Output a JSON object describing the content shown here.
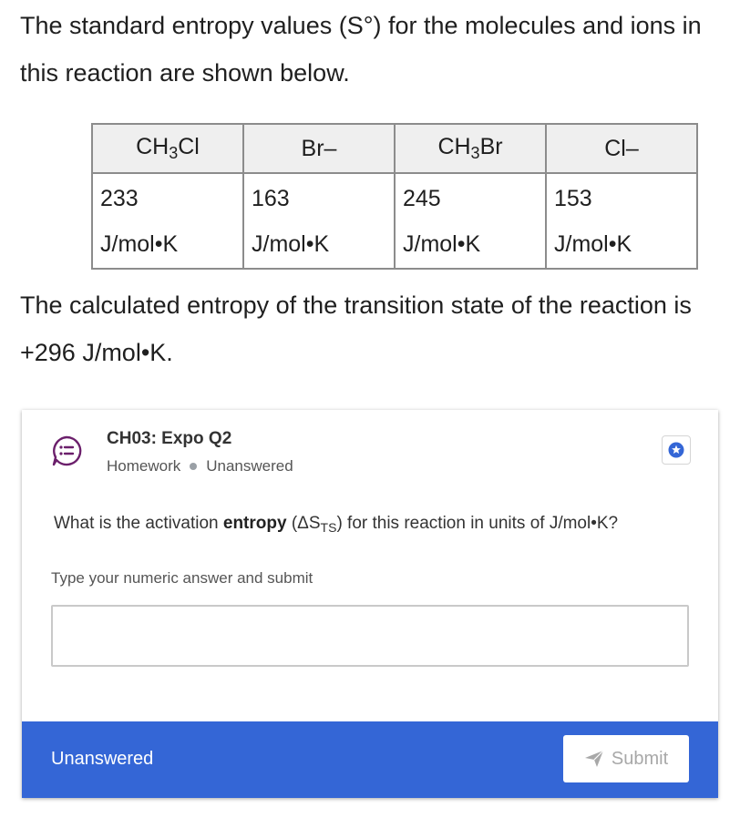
{
  "intro": {
    "line1": "The standard entropy values (S°) for the molecules and ions in this reaction are shown below."
  },
  "table": {
    "headers": [
      {
        "pre": "CH",
        "sub": "3",
        "post": "Cl"
      },
      {
        "pre": "Br–",
        "sub": "",
        "post": ""
      },
      {
        "pre": "CH",
        "sub": "3",
        "post": "Br"
      },
      {
        "pre": "Cl–",
        "sub": "",
        "post": ""
      }
    ],
    "values": [
      "233",
      "163",
      "245",
      "153"
    ],
    "unit": "J/mol•K"
  },
  "transition": "The calculated entropy of the transition state of the reaction is +296 J/mol•K.",
  "card": {
    "title": "CH03: Expo Q2",
    "type": "Homework",
    "status": "Unanswered",
    "question_pre": "What is the activation ",
    "question_bold": "entropy",
    "question_mid": " (ΔS",
    "question_sub": "TS",
    "question_post": ") for this reaction in units of J/mol•K?",
    "field_label": "Type your numeric answer and submit",
    "answer_value": "",
    "footer_status": "Unanswered",
    "submit_label": "Submit"
  },
  "colors": {
    "accent": "#3466d6",
    "icon_purple": "#6b1f6b",
    "star_blue": "#3466d6"
  },
  "icons": {
    "question": "question-list-icon",
    "star": "star-badge-icon",
    "submit": "send-arrow-icon"
  }
}
